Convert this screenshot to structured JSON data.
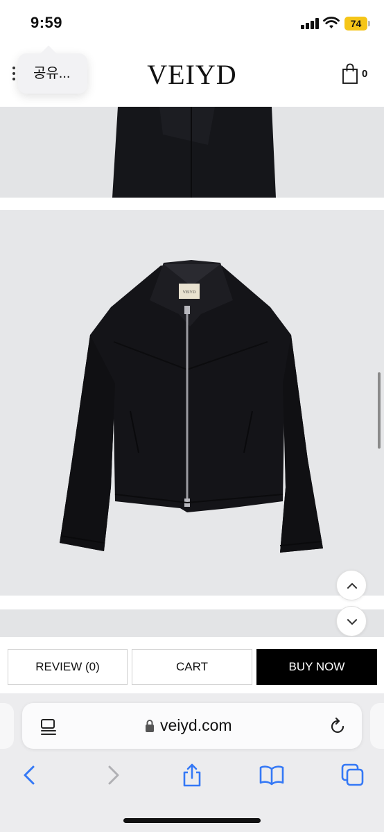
{
  "status_bar": {
    "time": "9:59",
    "battery": "74",
    "battery_color": "#f5c518"
  },
  "header": {
    "share_popup": "공유...",
    "logo": "VEIYD",
    "cart_count": "0",
    "icons": [
      "menu-dots-icon",
      "shopping-bag-icon"
    ]
  },
  "product": {
    "label_tag": "VEIYD"
  },
  "actions": {
    "review_label": "REVIEW (0)",
    "cart_label": "CART",
    "buy_label": "BUY NOW",
    "buy_bg": "#000000"
  },
  "browser": {
    "url": "veiyd.com",
    "icons": [
      "reader-icon",
      "lock-icon",
      "reload-icon",
      "back-icon",
      "forward-icon",
      "share-icon",
      "bookmarks-icon",
      "tabs-icon"
    ],
    "accent": "#3478f6"
  }
}
